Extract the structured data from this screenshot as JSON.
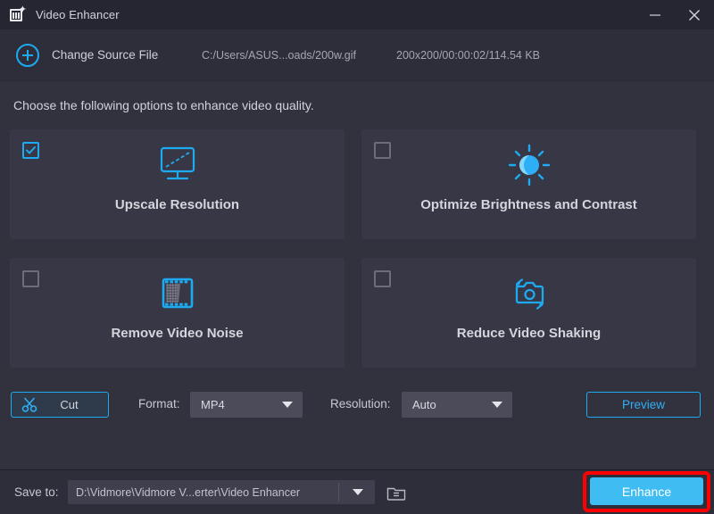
{
  "window": {
    "title": "Video Enhancer",
    "logo_icon": "video-enhancer-logo-icon",
    "minimize_label": "Minimize",
    "close_label": "Close"
  },
  "source_bar": {
    "add_icon": "plus-circle-icon",
    "change_source_label": "Change Source File",
    "file_path": "C:/Users/ASUS...oads/200w.gif",
    "file_meta": "200x200/00:00:02/114.54 KB"
  },
  "main": {
    "instruction": "Choose the following options to enhance video quality.",
    "options": [
      {
        "label": "Upscale Resolution",
        "checked": true,
        "icon": "monitor-upscale-icon"
      },
      {
        "label": "Optimize Brightness and Contrast",
        "checked": false,
        "icon": "sun-brightness-icon"
      },
      {
        "label": "Remove Video Noise",
        "checked": false,
        "icon": "film-strip-noise-icon"
      },
      {
        "label": "Reduce Video Shaking",
        "checked": false,
        "icon": "camera-shake-icon"
      }
    ]
  },
  "options_row": {
    "cut_label": "Cut",
    "cut_icon": "scissors-icon",
    "format_label": "Format:",
    "format_value": "MP4",
    "resolution_label": "Resolution:",
    "resolution_value": "Auto",
    "preview_label": "Preview",
    "caret_icon": "chevron-down-icon"
  },
  "bottom_bar": {
    "save_to_label": "Save to:",
    "save_path": "D:\\Vidmore\\Vidmore V...erter\\Video Enhancer",
    "folder_icon": "folder-open-icon",
    "enhance_label": "Enhance"
  },
  "colors": {
    "accent_blue": "#1eaaf1",
    "enhance_blue": "#3fbdf2",
    "highlight_red": "#fe0000",
    "window_bg": "#32323f",
    "titlebar_bg": "#262632",
    "card_bg": "#373745"
  }
}
